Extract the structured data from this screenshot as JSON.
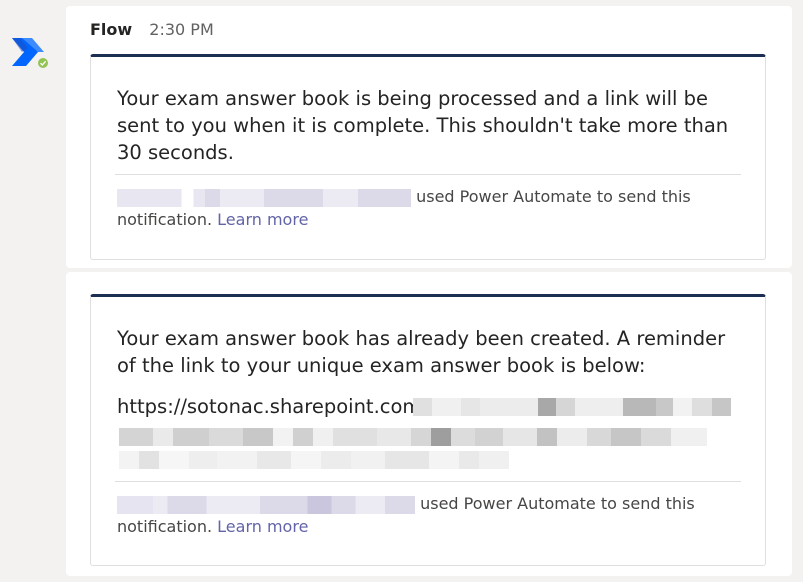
{
  "sender": "Flow",
  "time": "2:30 PM",
  "messages": [
    {
      "card_text": "Your exam answer book is being processed and a link will be sent to you when it is complete. This shouldn't take more than 30 seconds.",
      "notice": "used Power Automate to send this notification.",
      "notice_a": "used Power Automate to send this",
      "notice_b": "notification.",
      "learn_more": "Learn more"
    },
    {
      "card_text": "Your exam answer book has already been created. A reminder of the link to your unique exam answer book is below:",
      "url_prefix": "https://sotonac.sharepoint.com/",
      "notice_a": "used Power Automate to send this",
      "notice_b": "notification.",
      "learn_more": "Learn more"
    }
  ],
  "colors": {
    "accent_bar": "#1b2f52",
    "link": "#6264a7",
    "presence": "#92c353"
  },
  "icons": {
    "avatar": "power-automate-logo",
    "presence": "available-check"
  }
}
